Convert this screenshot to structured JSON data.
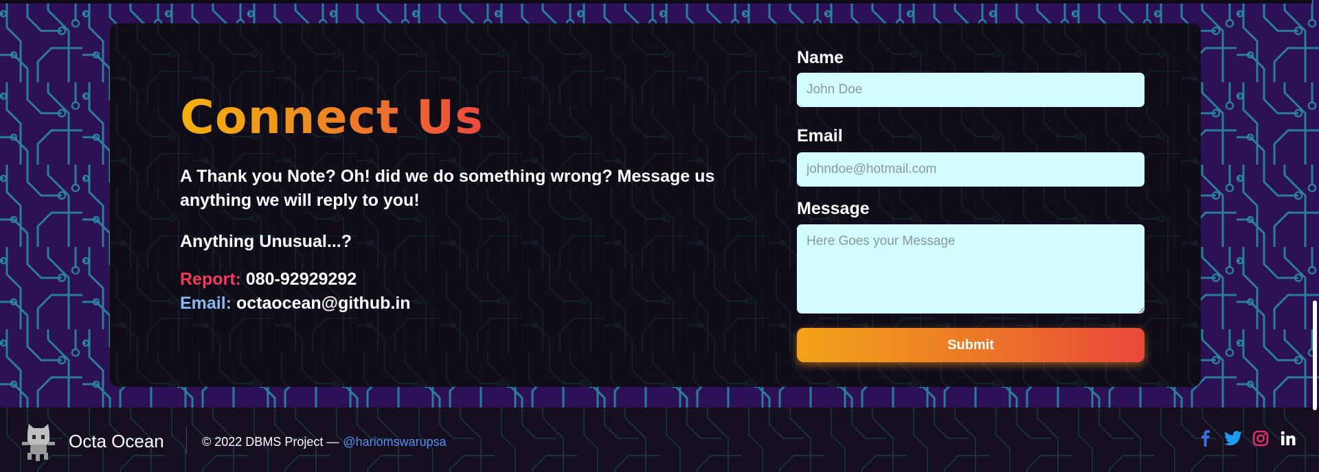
{
  "contact": {
    "heading": "Connect Us",
    "lead": "A Thank you Note? Oh! did we do something wrong? Message us anything we will reply to you!",
    "unusual": "Anything Unusual...?",
    "report_label": "Report:",
    "report_value": "080-92929292",
    "email_label": "Email:",
    "email_value": "octaocean@github.in"
  },
  "form": {
    "name_label": "Name",
    "name_placeholder": "John Doe",
    "email_label": "Email",
    "email_placeholder": "johndoe@hotmail.com",
    "message_label": "Message",
    "message_placeholder": "Here Goes your Message",
    "submit_label": "Submit"
  },
  "footer": {
    "brand": "Octa Ocean",
    "copyright": "© 2022 DBMS Project —",
    "handle": "@hariomswarupsa",
    "socials": [
      "facebook-icon",
      "twitter-icon",
      "instagram-icon",
      "linkedin-icon"
    ]
  },
  "colors": {
    "background": "#2d1158",
    "circuit": "#2a8fa8",
    "card": "#100d16",
    "input": "#d1fbfd",
    "heading_gradient": [
      "#f4b10f",
      "#ec4a3d"
    ],
    "report": "#f23b5c",
    "email": "#8ab8f0",
    "handle": "#5b8ef0"
  }
}
